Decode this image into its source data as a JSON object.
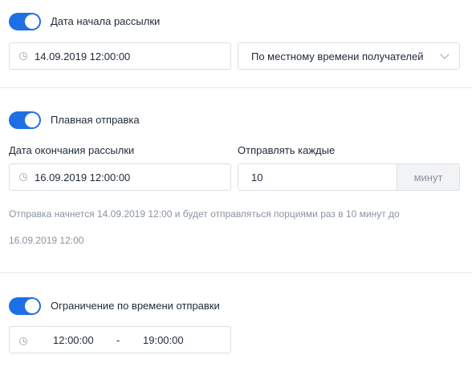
{
  "start": {
    "toggle_on": true,
    "label": "Дата начала рассылки",
    "datetime": "14.09.2019 12:00:00",
    "timezone_select": "По местному времени получателей"
  },
  "smooth": {
    "toggle_on": true,
    "label": "Плавная отправка",
    "end_label": "Дата окончания рассылки",
    "end_datetime": "16.09.2019 12:00:00",
    "every_label": "Отправлять каждые",
    "every_value": "10",
    "every_unit": "минут",
    "hint_line1": "Отправка начнется 14.09.2019 12:00 и будет отправляться порциями раз в 10 минут до",
    "hint_line2": "16.09.2019 12:00"
  },
  "time_limit": {
    "toggle_on": true,
    "label": "Ограничение по времени отправки",
    "from": "12:00:00",
    "separator": "-",
    "to": "19:00:00"
  },
  "colors": {
    "accent": "#1e6fe6",
    "hint_text": "#8a93a0",
    "border": "#dcdfe6"
  },
  "icons": [
    "clock-icon",
    "chevron-down-icon"
  ]
}
